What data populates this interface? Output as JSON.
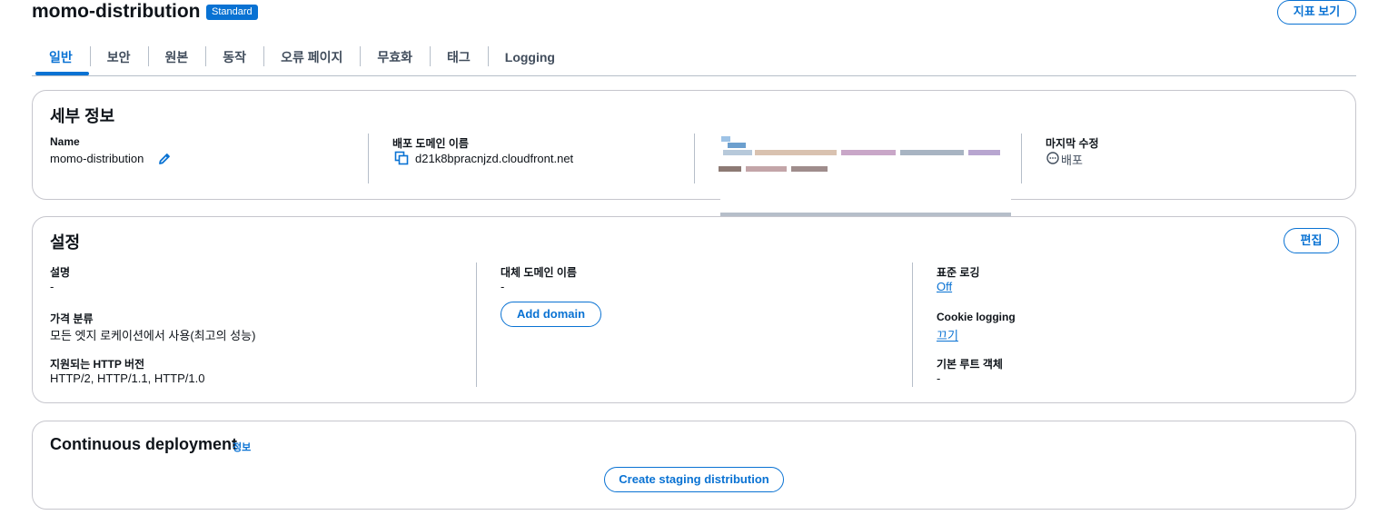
{
  "header": {
    "title": "momo-distribution",
    "badge": "Standard",
    "metrics_button": "지표 보기"
  },
  "tabs": [
    {
      "label": "일반",
      "active": true
    },
    {
      "label": "보안"
    },
    {
      "label": "원본"
    },
    {
      "label": "동작"
    },
    {
      "label": "오류 페이지"
    },
    {
      "label": "무효화"
    },
    {
      "label": "태그"
    },
    {
      "label": "Logging"
    }
  ],
  "details": {
    "title": "세부 정보",
    "name_label": "Name",
    "name_value": "momo-distribution",
    "domain_label": "배포 도메인 이름",
    "domain_value": "d21k8bpracnjzd.cloudfront.net",
    "modified_label": "마지막 수정",
    "modified_value": "배포"
  },
  "settings": {
    "title": "설정",
    "edit_button": "편집",
    "description_label": "설명",
    "description_value": "-",
    "price_class_label": "가격 분류",
    "price_class_value": "모든 엣지 로케이션에서 사용(최고의 성능)",
    "http_label": "지원되는 HTTP 버전",
    "http_value": "HTTP/2, HTTP/1.1, HTTP/1.0",
    "alt_domain_label": "대체 도메인 이름",
    "alt_domain_value": "-",
    "add_domain_button": "Add domain",
    "std_logging_label": "표준 로깅",
    "std_logging_value": "Off",
    "cookie_logging_label": "Cookie logging",
    "cookie_logging_value": "끄기",
    "root_object_label": "기본 루트 객체",
    "root_object_value": "-"
  },
  "continuous_deployment": {
    "title": "Continuous deployment",
    "info_link": "정보",
    "create_button": "Create staging distribution"
  },
  "colors": {
    "accent": "#0972d3",
    "text": "#0f141a",
    "border": "#c6c6cd"
  }
}
